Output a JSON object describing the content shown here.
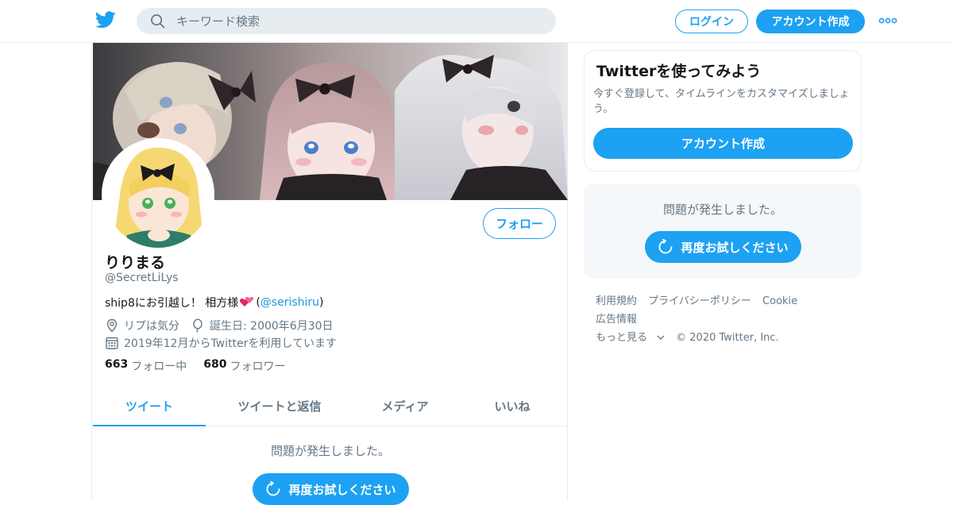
{
  "header": {
    "search_placeholder": "キーワード検索",
    "login_label": "ログイン",
    "signup_label": "アカウント作成",
    "brand_color": "#1da1f2"
  },
  "profile": {
    "follow_label": "フォロー",
    "name": "りりまる",
    "handle": "@SecretLiLys",
    "bio_prefix": "ship8にお引越し！ 相方様",
    "bio_link": "@serishiru",
    "location": "リプは気分",
    "birthday": "誕生日: 2000年6月30日",
    "joined": "2019年12月からTwitterを利用しています",
    "following_count": "663",
    "following_label": "フォロー中",
    "followers_count": "680",
    "followers_label": "フォロワー"
  },
  "tabs": [
    {
      "label": "ツイート"
    },
    {
      "label": "ツイートと返信"
    },
    {
      "label": "メディア"
    },
    {
      "label": "いいね"
    }
  ],
  "timeline_error": {
    "message": "問題が発生しました。",
    "retry_label": "再度お試しください"
  },
  "sidebar": {
    "signup_card": {
      "title": "Twitterを使ってみよう",
      "text": "今すぐ登録して、タイムラインをカスタマイズしましょう。",
      "button_label": "アカウント作成"
    },
    "error_card": {
      "message": "問題が発生しました。",
      "retry_label": "再度お試しください"
    },
    "footer": {
      "links": [
        "利用規約",
        "プライバシーポリシー",
        "Cookie",
        "広告情報"
      ],
      "more_label": "もっと見る",
      "copyright": "© 2020 Twitter, Inc."
    }
  }
}
